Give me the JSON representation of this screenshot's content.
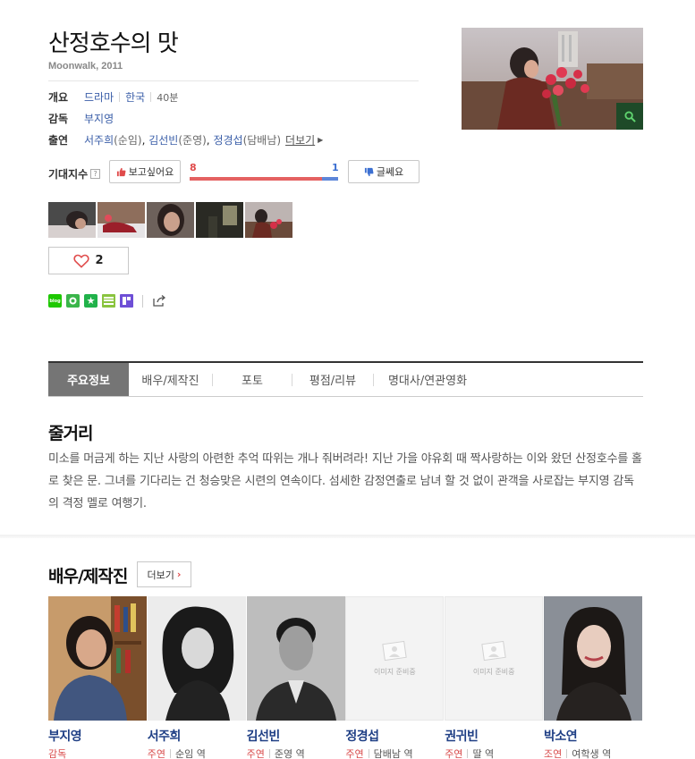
{
  "movie": {
    "title": "산정호수의 맛",
    "subtitle": "Moonwalk, 2011",
    "overview_label": "개요",
    "genre": "드라마",
    "country": "한국",
    "runtime": "40분",
    "director_label": "감독",
    "director": "부지영",
    "cast_label": "출연",
    "cast_list": [
      {
        "name": "서주희",
        "role": "(순임)"
      },
      {
        "name": "김선빈",
        "role": "(준영)"
      },
      {
        "name": "정경섭",
        "role": "(담배남)"
      }
    ],
    "cast_more": "더보기"
  },
  "expect": {
    "label": "기대지수",
    "help": "?",
    "like_label": "보고싶어요",
    "dislike_label": "글쎄요",
    "like_count": "8",
    "dislike_count": "1",
    "like_ratio": 0.89
  },
  "heart": {
    "count": "2"
  },
  "tabs": [
    "주요정보",
    "배우/제작진",
    "포토",
    "평점/리뷰",
    "명대사/연관영화"
  ],
  "synopsis": {
    "title": "줄거리",
    "text": "미소를 머금게 하는 지난 사랑의 아련한 추억 따위는 개나 줘버려라! 지난 가을 야유회 때 짝사랑하는 이와 왔던 산정호수를 홀로 찾은 문. 그녀를 기다리는 건 청승맞은 시련의 연속이다. 섬세한 감정연출로 남녀 할 것 없이 관객을 사로잡는 부지영 감독의 격정 멜로 여행기."
  },
  "crew": {
    "title": "배우/제작진",
    "more": "더보기",
    "people": [
      {
        "name": "부지영",
        "type": "감독",
        "role": ""
      },
      {
        "name": "서주희",
        "type": "주연",
        "role": "순임 역"
      },
      {
        "name": "김선빈",
        "type": "주연",
        "role": "준영 역"
      },
      {
        "name": "정경섭",
        "type": "주연",
        "role": "담배남 역"
      },
      {
        "name": "권귀빈",
        "type": "주연",
        "role": "딸 역"
      },
      {
        "name": "박소연",
        "type": "조연",
        "role": "여학생 역"
      }
    ],
    "no_image_text": "이미지 준비중"
  }
}
